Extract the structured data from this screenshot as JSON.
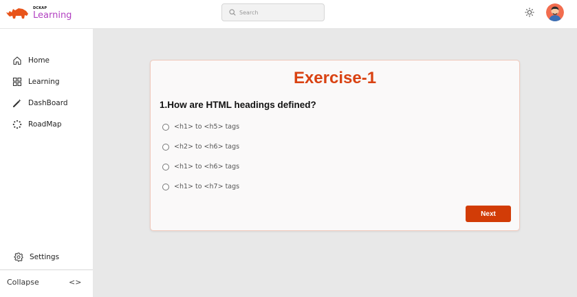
{
  "brand": {
    "small": "DCKAP",
    "name": "Learning",
    "accent": "#b13fc1",
    "logo_color": "#e8541a"
  },
  "search": {
    "placeholder": "Search",
    "icon": "search-icon"
  },
  "header": {
    "theme_icon": "sun-icon",
    "avatar": "user-avatar"
  },
  "sidebar": {
    "items": [
      {
        "label": "Home",
        "icon": "home-icon"
      },
      {
        "label": "Learning",
        "icon": "grid-icon"
      },
      {
        "label": "DashBoard",
        "icon": "magic-wand-icon"
      },
      {
        "label": "RoadMap",
        "icon": "loader-icon"
      }
    ],
    "settings": {
      "label": "Settings",
      "icon": "gear-icon"
    },
    "collapse": {
      "label": "Collapse",
      "icon_text": "<>"
    }
  },
  "exercise": {
    "title": "Exercise-1",
    "question": "1.How are HTML headings defined?",
    "options": [
      "<h1> to <h5> tags",
      "<h2> to <h6> tags",
      "<h1> to <h6> tags",
      "<h1> to <h7> tags"
    ],
    "next_label": "Next",
    "title_color": "#d94212",
    "button_color": "#d23c07"
  }
}
